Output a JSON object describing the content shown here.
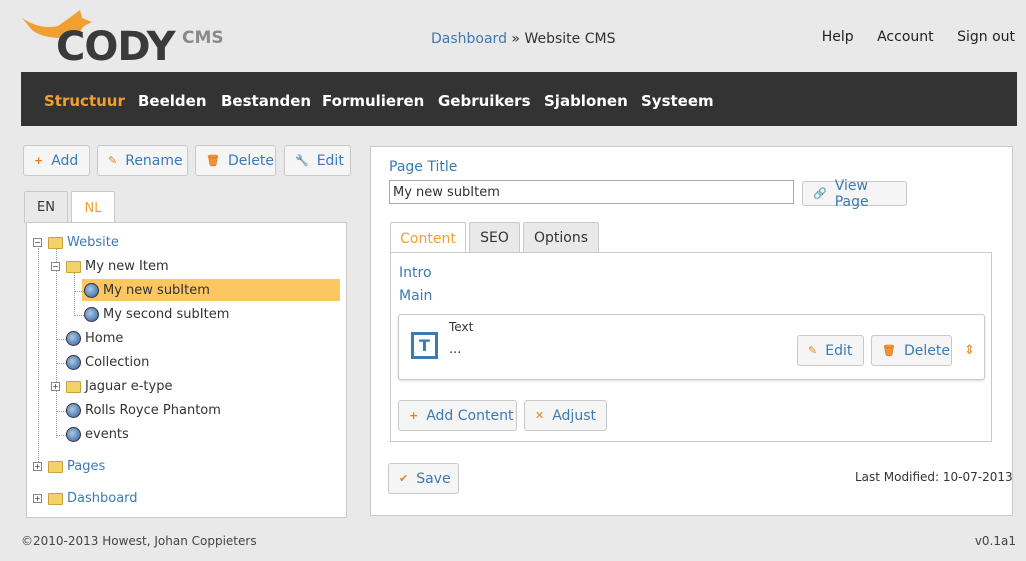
{
  "brand": {
    "logo_text": "CODY",
    "logo_suffix": "CMS"
  },
  "breadcrumb": {
    "link": "Dashboard",
    "separator": "»",
    "current": "Website CMS"
  },
  "top_links": [
    "Help",
    "Account",
    "Sign out"
  ],
  "nav": {
    "items": [
      "Structuur",
      "Beelden",
      "Bestanden",
      "Formulieren",
      "Gebruikers",
      "Sjablonen",
      "Systeem"
    ],
    "active_index": 0
  },
  "tree_toolbar": {
    "add": "Add",
    "rename": "Rename",
    "delete": "Delete",
    "edit": "Edit"
  },
  "language_tabs": {
    "items": [
      "EN",
      "NL"
    ],
    "active": "NL"
  },
  "tree": {
    "website": "Website",
    "my_new_item": "My new Item",
    "my_new_subitem": "My new subItem",
    "my_second_subitem": "My second subItem",
    "home": "Home",
    "collection": "Collection",
    "jaguar": "Jaguar e-type",
    "rolls": "Rolls Royce Phantom",
    "events": "events",
    "pages": "Pages",
    "dashboard": "Dashboard",
    "selected": "My new subItem"
  },
  "editor": {
    "page_title_label": "Page Title",
    "page_title_value": "My new subItem",
    "view_page": "View Page",
    "tabs": [
      "Content",
      "SEO",
      "Options"
    ],
    "active_tab": "Content",
    "intro_label": "Intro",
    "main_label": "Main",
    "block": {
      "type": "Text",
      "content": "...",
      "edit": "Edit",
      "delete": "Delete"
    },
    "add_content": "Add Content",
    "adjust": "Adjust",
    "save": "Save",
    "last_modified": "Last Modified: 10-07-2013"
  },
  "footer": {
    "copyright": "©2010-2013 Howest, Johan Coppieters",
    "version": "v0.1a1"
  },
  "colors": {
    "accent": "#f0a030",
    "link": "#3b7ab5",
    "nav_bg": "#333333",
    "selection": "#fcc660"
  }
}
